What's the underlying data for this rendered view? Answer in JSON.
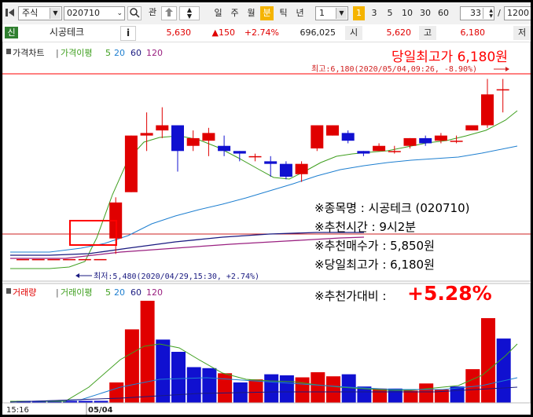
{
  "toolbar": {
    "market_select": "주식",
    "code_input": "020710",
    "search_label": "관",
    "period_buttons": [
      "일",
      "주",
      "월",
      "분",
      "틱",
      "년"
    ],
    "active_period": "분",
    "interval_value": "1",
    "num_badge": "1",
    "quick_intervals": [
      "3",
      "5",
      "10",
      "30",
      "60"
    ],
    "count_value": "33",
    "separator": "/",
    "total_value": "1200"
  },
  "quote": {
    "badge": "신",
    "name": "시공테크",
    "info_label": "i",
    "price": "5,630",
    "change": "▲150",
    "change_pct": "+2.74%",
    "volume": "696,025",
    "open_label": "시",
    "open": "5,620",
    "high_label": "고",
    "high": "6,180",
    "low_label": "저"
  },
  "price_legend": {
    "title": "가격차트",
    "ma_title": "가격이평",
    "periods": [
      "5",
      "20",
      "60",
      "120"
    ]
  },
  "volume_legend": {
    "title": "거래량",
    "ma_title": "거래이평",
    "periods": [
      "5",
      "20",
      "60",
      "120"
    ]
  },
  "annotations": {
    "day_high_title": "당일최고가 6,180원",
    "high_marker": "최고:6,180(2020/05/04,09:26, -8.90%)",
    "low_marker": "최저:5,480(2020/04/29,15:30, +2.74%)",
    "info_lines": [
      "※종목명 : 시공테크 (020710)",
      "※추천시간 : 9시2분",
      "※추천매수가 : 5,850원",
      "※당일최고가 : 6,180원"
    ],
    "ratio_label": "※추천가대비 :",
    "ratio_value": "+5.28%"
  },
  "xaxis": {
    "left_time": "15:16",
    "date_label": "05/04"
  },
  "colors": {
    "up": "#e00000",
    "down": "#1010d0",
    "ma5": "#3f9f1f",
    "ma20": "#1e7fd0",
    "ma60": "#1a1a80",
    "ma120": "#9a2080",
    "highlight": "#ff0000",
    "active_period_bg": "#f5b400"
  },
  "icons": [
    "chart-toggle-icon",
    "search-icon",
    "cart-icon",
    "stepper-arrows-icon",
    "dropdown-chevron-icon"
  ],
  "chart_data": {
    "type": "candlestick",
    "price_ylim": [
      5440,
      6200
    ],
    "candles": [
      {
        "o": 5480,
        "c": 5480,
        "h": 5480,
        "l": 5480
      },
      {
        "o": 5480,
        "c": 5480,
        "h": 5480,
        "l": 5480
      },
      {
        "o": 5480,
        "c": 5480,
        "h": 5480,
        "l": 5480
      },
      {
        "o": 5480,
        "c": 5480,
        "h": 5480,
        "l": 5480
      },
      {
        "o": 5480,
        "c": 5480,
        "h": 5480,
        "l": 5480
      },
      {
        "o": 5480,
        "c": 5480,
        "h": 5480,
        "l": 5480
      },
      {
        "o": 5560,
        "c": 5700,
        "h": 5720,
        "l": 5500
      },
      {
        "o": 5740,
        "c": 5960,
        "h": 5960,
        "l": 5740
      },
      {
        "o": 5960,
        "c": 5970,
        "h": 6050,
        "l": 5900
      },
      {
        "o": 5980,
        "c": 6000,
        "h": 6070,
        "l": 5950
      },
      {
        "o": 6000,
        "c": 5900,
        "h": 6000,
        "l": 5820
      },
      {
        "o": 5920,
        "c": 5950,
        "h": 5980,
        "l": 5900
      },
      {
        "o": 5940,
        "c": 5970,
        "h": 5990,
        "l": 5880
      },
      {
        "o": 5920,
        "c": 5900,
        "h": 5960,
        "l": 5880
      },
      {
        "o": 5900,
        "c": 5890,
        "h": 5900,
        "l": 5860
      },
      {
        "o": 5880,
        "c": 5880,
        "h": 5890,
        "l": 5860
      },
      {
        "o": 5860,
        "c": 5850,
        "h": 5880,
        "l": 5800
      },
      {
        "o": 5850,
        "c": 5800,
        "h": 5860,
        "l": 5790
      },
      {
        "o": 5810,
        "c": 5850,
        "h": 5860,
        "l": 5780
      },
      {
        "o": 5910,
        "c": 6000,
        "h": 6000,
        "l": 5900
      },
      {
        "o": 5960,
        "c": 6000,
        "h": 6000,
        "l": 5960
      },
      {
        "o": 5970,
        "c": 5940,
        "h": 5980,
        "l": 5930
      },
      {
        "o": 5900,
        "c": 5890,
        "h": 5900,
        "l": 5880
      },
      {
        "o": 5900,
        "c": 5920,
        "h": 5930,
        "l": 5900
      },
      {
        "o": 5900,
        "c": 5900,
        "h": 5920,
        "l": 5890
      },
      {
        "o": 5920,
        "c": 5950,
        "h": 5950,
        "l": 5910
      },
      {
        "o": 5950,
        "c": 5930,
        "h": 5960,
        "l": 5920
      },
      {
        "o": 5940,
        "c": 5960,
        "h": 5970,
        "l": 5930
      },
      {
        "o": 5940,
        "c": 5940,
        "h": 5960,
        "l": 5930
      },
      {
        "o": 5980,
        "c": 6000,
        "h": 6000,
        "l": 5980
      },
      {
        "o": 6000,
        "c": 6120,
        "h": 6180,
        "l": 5990
      },
      {
        "o": 6140,
        "c": 6140,
        "h": 6180,
        "l": 6050
      }
    ],
    "volumes": [
      0.02,
      0.02,
      0.02,
      0.02,
      0.02,
      0.02,
      0.2,
      0.72,
      1.0,
      0.62,
      0.5,
      0.35,
      0.34,
      0.29,
      0.2,
      0.23,
      0.28,
      0.27,
      0.25,
      0.3,
      0.26,
      0.28,
      0.16,
      0.14,
      0.14,
      0.12,
      0.19,
      0.13,
      0.16,
      0.33,
      0.83,
      0.63
    ],
    "volume_up": [
      false,
      false,
      false,
      false,
      false,
      false,
      true,
      true,
      true,
      false,
      false,
      false,
      false,
      true,
      false,
      true,
      false,
      false,
      true,
      true,
      true,
      false,
      false,
      true,
      false,
      true,
      true,
      true,
      false,
      true,
      true,
      false
    ]
  }
}
